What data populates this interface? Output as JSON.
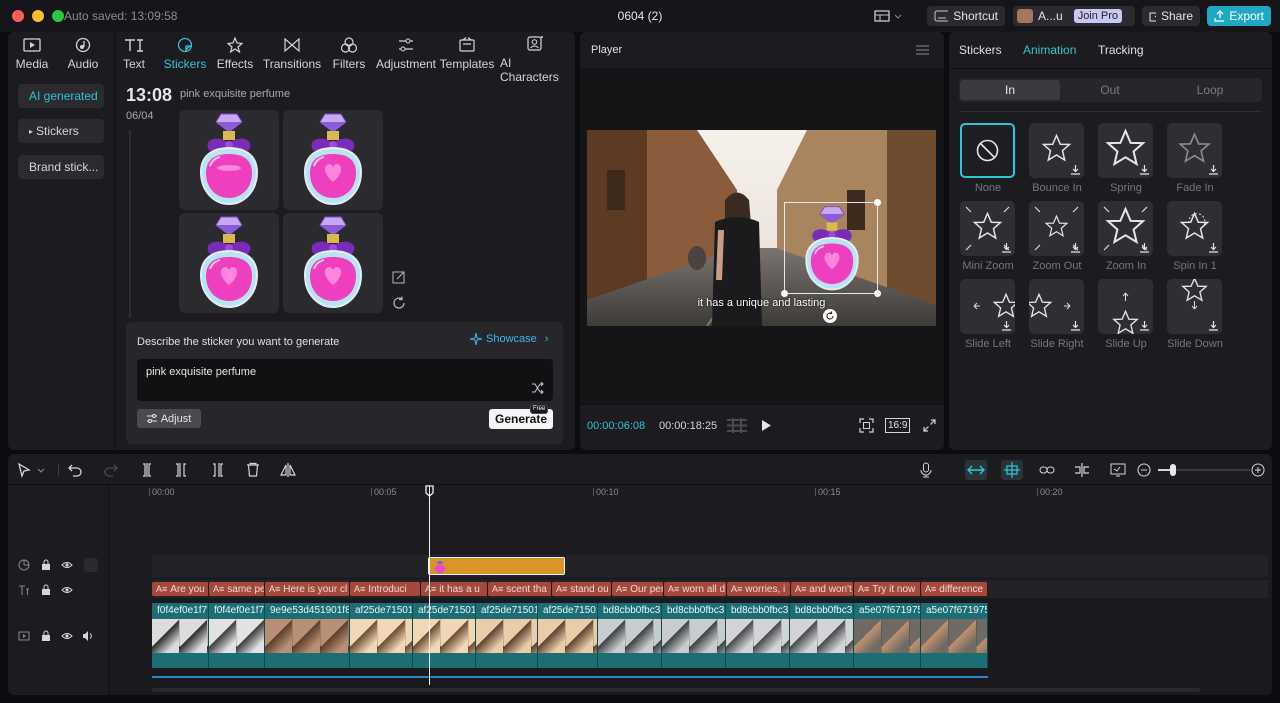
{
  "titlebar": {
    "autosaved": "Auto saved: 13:09:58",
    "title": "0604 (2)",
    "shortcut": "Shortcut",
    "account": "A...u",
    "join_pro": "Join Pro",
    "share": "Share",
    "export": "Export"
  },
  "tools": [
    {
      "label": "Media",
      "icon": "media-icon"
    },
    {
      "label": "Audio",
      "icon": "audio-icon"
    },
    {
      "label": "Text",
      "icon": "text-icon"
    },
    {
      "label": "Stickers",
      "icon": "stickers-icon"
    },
    {
      "label": "Effects",
      "icon": "effects-icon"
    },
    {
      "label": "Transitions",
      "icon": "transitions-icon"
    },
    {
      "label": "Filters",
      "icon": "filters-icon"
    },
    {
      "label": "Adjustment",
      "icon": "adjustment-icon"
    },
    {
      "label": "Templates",
      "icon": "templates-icon"
    },
    {
      "label": "AI Characters",
      "icon": "ai-characters-icon"
    }
  ],
  "sidebar": {
    "ai_generated": "AI generated",
    "stickers": "Stickers",
    "brand": "Brand stick..."
  },
  "generated": {
    "time": "13:08",
    "date": "06/04",
    "prompt": "pink exquisite perfume"
  },
  "generate_box": {
    "describe": "Describe the sticker you want to generate",
    "showcase": "Showcase",
    "input_value": "pink exquisite perfume",
    "adjust": "Adjust",
    "generate": "Generate",
    "free_badge": "Free"
  },
  "player": {
    "title": "Player",
    "subtitle": "it has a unique and lasting",
    "current_time": "00:00:06:08",
    "total_time": "00:00:18:25",
    "ratio": "16:9"
  },
  "right_panel": {
    "tabs": [
      "Stickers",
      "Animation",
      "Tracking"
    ],
    "segments": [
      "In",
      "Out",
      "Loop"
    ],
    "animations": [
      "None",
      "Bounce In",
      "Spring",
      "Fade In",
      "Mini Zoom",
      "Zoom Out",
      "Zoom In",
      "Spin In 1",
      "Slide Left",
      "Slide Right",
      "Slide Up",
      "Slide Down"
    ]
  },
  "timeline": {
    "ruler": [
      "00:00",
      "00:05",
      "00:10",
      "00:15",
      "00:20"
    ],
    "text_clips": [
      "Are you",
      "same pe",
      "Here is your cl",
      "Introduci",
      "it has a u",
      "scent tha",
      "stand ou",
      "Our perfu",
      "worn all d",
      "worries, i",
      "and won't",
      "Try it now",
      "difference"
    ],
    "video_clips": [
      "f0f4ef0e1f7",
      "f0f4ef0e1f7",
      "9e9e53d451901f8",
      "af25de71501",
      "af25de71501",
      "af25de71501",
      "af25de71501",
      "bd8cbb0fbc3",
      "bd8cbb0fbc3",
      "bd8cbb0fbc3",
      "bd8cbb0fbc3",
      "a5e07f671975",
      "a5e07f671975"
    ]
  },
  "colors": {
    "accent": "#2ec5d6",
    "text_clip": "#a4493b",
    "video_clip": "#1d6e74",
    "sticker_clip": "#d9952a"
  }
}
